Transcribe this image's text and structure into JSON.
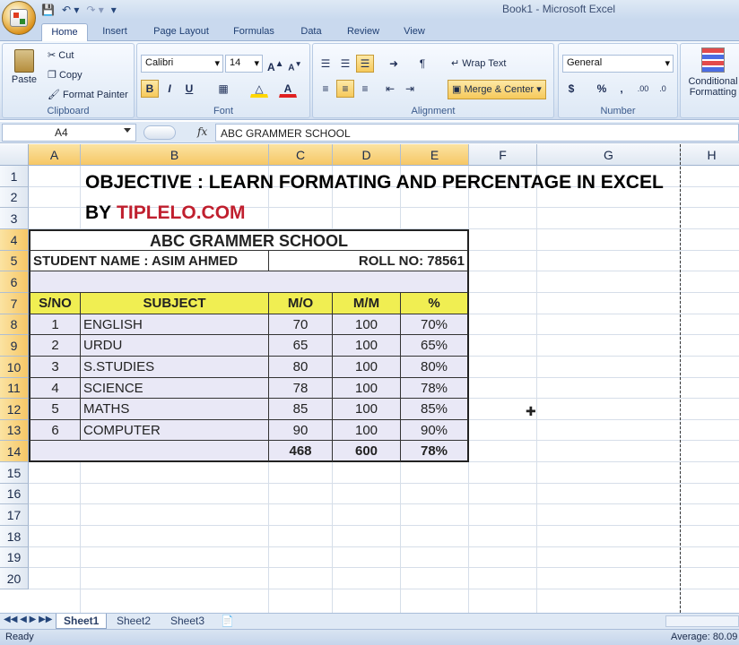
{
  "window": {
    "title": "Book1 - Microsoft Excel"
  },
  "quick_access": {
    "save_icon": "save-icon",
    "undo_icon": "undo-icon",
    "redo_icon": "redo-icon"
  },
  "tabs": [
    {
      "label": "Home"
    },
    {
      "label": "Insert"
    },
    {
      "label": "Page Layout"
    },
    {
      "label": "Formulas"
    },
    {
      "label": "Data"
    },
    {
      "label": "Review"
    },
    {
      "label": "View"
    }
  ],
  "ribbon": {
    "clipboard": {
      "label": "Clipboard",
      "paste": "Paste",
      "cut": "Cut",
      "copy": "Copy",
      "format_painter": "Format Painter"
    },
    "font": {
      "label": "Font",
      "name": "Calibri",
      "size": "14",
      "bold": "B",
      "italic": "I",
      "underline": "U"
    },
    "alignment": {
      "label": "Alignment",
      "wrap_text": "Wrap Text",
      "merge_center": "Merge & Center"
    },
    "number": {
      "label": "Number",
      "format": "General",
      "currency": "$",
      "percent": "%",
      "comma": ","
    },
    "styles": {
      "conditional": "Conditional",
      "formatting": "Formatting"
    }
  },
  "formula_bar": {
    "name_box": "A4",
    "fx": "fx",
    "content": "ABC GRAMMER SCHOOL"
  },
  "columns": [
    "A",
    "B",
    "C",
    "D",
    "E",
    "F",
    "G",
    "H"
  ],
  "rows": [
    "1",
    "2",
    "3",
    "4",
    "5",
    "6",
    "7",
    "8",
    "9",
    "10",
    "11",
    "12",
    "13",
    "14",
    "15",
    "16",
    "17",
    "18",
    "19",
    "20"
  ],
  "sheet": {
    "objective": "OBJECTIVE : LEARN FORMATING AND PERCENTAGE IN EXCEL",
    "by_label": "BY",
    "by_site": "TIPLELO.COM",
    "school": "ABC GRAMMER SCHOOL",
    "student": "STUDENT NAME : ASIM AHMED",
    "roll": "ROLL NO: 78561",
    "headers": {
      "sno": "S/NO",
      "subject": "SUBJECT",
      "mo": "M/O",
      "mm": "M/M",
      "pct": "%"
    },
    "records": [
      {
        "sno": "1",
        "subject": "ENGLISH",
        "mo": "70",
        "mm": "100",
        "pct": "70%"
      },
      {
        "sno": "2",
        "subject": "URDU",
        "mo": "65",
        "mm": "100",
        "pct": "65%"
      },
      {
        "sno": "3",
        "subject": "S.STUDIES",
        "mo": "80",
        "mm": "100",
        "pct": "80%"
      },
      {
        "sno": "4",
        "subject": "SCIENCE",
        "mo": "78",
        "mm": "100",
        "pct": "78%"
      },
      {
        "sno": "5",
        "subject": "MATHS",
        "mo": "85",
        "mm": "100",
        "pct": "85%"
      },
      {
        "sno": "6",
        "subject": "COMPUTER",
        "mo": "90",
        "mm": "100",
        "pct": "90%"
      }
    ],
    "totals": {
      "mo": "468",
      "mm": "600",
      "pct": "78%"
    }
  },
  "sheet_tabs": [
    {
      "label": "Sheet1"
    },
    {
      "label": "Sheet2"
    },
    {
      "label": "Sheet3"
    }
  ],
  "status": {
    "ready": "Ready",
    "average": "Average: 80.09"
  },
  "colors": {
    "header_fill": "#f0ee52",
    "table_fill": "#e9e8f6",
    "brand_red": "#c01f2e",
    "selected_header": "#f6c766"
  }
}
